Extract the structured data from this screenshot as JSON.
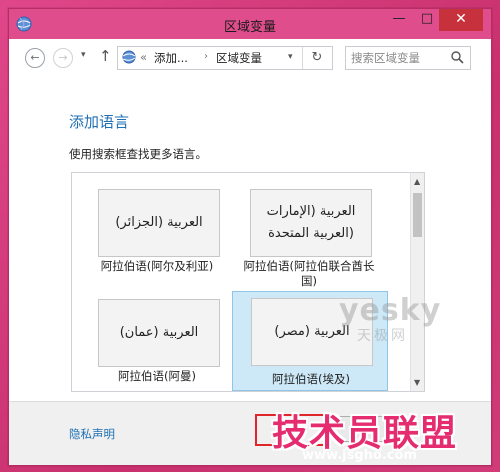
{
  "window": {
    "title": "区域变量",
    "controls": {
      "minimize": "—",
      "maximize": "□",
      "close": "✕"
    }
  },
  "nav": {
    "back_icon": "back-arrow-icon",
    "forward_icon": "forward-arrow-icon",
    "dropdown": "▾",
    "up": "↑",
    "address": {
      "prefix": "«",
      "crumbs": [
        "添加...",
        "区域变量"
      ],
      "separator": "›"
    },
    "refresh": "↻",
    "search": {
      "placeholder": "搜索区域变量"
    }
  },
  "main": {
    "heading": "添加语言",
    "hint": "使用搜索框查找更多语言。",
    "languages": [
      {
        "native": "العربية (الجزائر)",
        "label": "阿拉伯语(阿尔及利亚)",
        "selected": false
      },
      {
        "native": "العربية (الإمارات\nالعربية المتحدة)",
        "label": "阿拉伯语(阿拉伯联合酋长国)",
        "selected": false
      },
      {
        "native": "العربية (عمان)",
        "label": "阿拉伯语(阿曼)",
        "selected": false
      },
      {
        "native": "العربية (مصر)",
        "label": "阿拉伯语(埃及)",
        "selected": true
      }
    ]
  },
  "footer": {
    "privacy_link": "隐私声明",
    "add_button": "",
    "cancel_button": ""
  },
  "watermarks": {
    "yesky": "yesky",
    "yesky_cn": "天极网",
    "site_cn": "技术员联盟",
    "site_url": "www.jsgho.com"
  },
  "colors": {
    "titlebar": "#e04d8c",
    "close": "#c7313c",
    "link": "#1e6fb3",
    "selected": "#cde8f7"
  }
}
